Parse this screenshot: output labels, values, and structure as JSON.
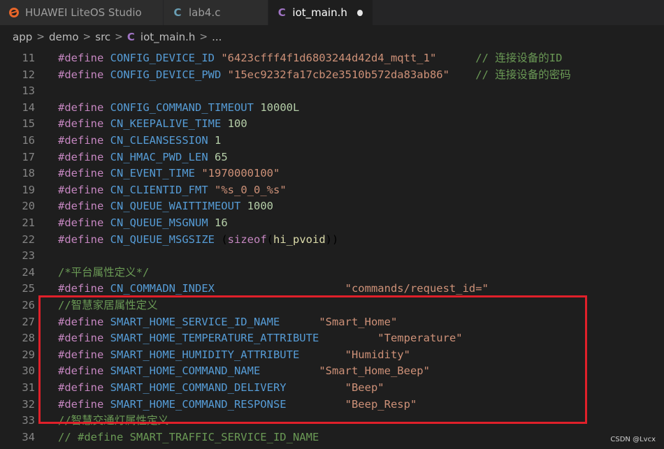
{
  "tabs": [
    {
      "label": "HUAWEI LiteOS Studio",
      "icon": "huawei-liteos-logo-icon"
    },
    {
      "label": "lab4.c",
      "icon": "c-file-icon"
    },
    {
      "label": "iot_main.h",
      "icon": "c-header-file-icon",
      "active": true,
      "modified": true
    }
  ],
  "breadcrumb": [
    "app",
    "demo",
    "src",
    "iot_main.h",
    "..."
  ],
  "lines": [
    {
      "n": "11",
      "t": "#define CONFIG_DEVICE_ID \"6423cfff4f1d6803244d42d4_mqtt_1\"      // 连接设备的ID"
    },
    {
      "n": "12",
      "t": "#define CONFIG_DEVICE_PWD \"15ec9232fa17cb2e3510b572da83ab86\"    // 连接设备的密码"
    },
    {
      "n": "13",
      "t": ""
    },
    {
      "n": "14",
      "t": "#define CONFIG_COMMAND_TIMEOUT 10000L"
    },
    {
      "n": "15",
      "t": "#define CN_KEEPALIVE_TIME 100"
    },
    {
      "n": "16",
      "t": "#define CN_CLEANSESSION 1"
    },
    {
      "n": "17",
      "t": "#define CN_HMAC_PWD_LEN 65"
    },
    {
      "n": "18",
      "t": "#define CN_EVENT_TIME \"1970000100\""
    },
    {
      "n": "19",
      "t": "#define CN_CLIENTID_FMT \"%s_0_0_%s\""
    },
    {
      "n": "20",
      "t": "#define CN_QUEUE_WAITTIMEOUT 1000"
    },
    {
      "n": "21",
      "t": "#define CN_QUEUE_MSGNUM 16"
    },
    {
      "n": "22",
      "t": "#define CN_QUEUE_MSGSIZE (sizeof(hi_pvoid))"
    },
    {
      "n": "23",
      "t": ""
    },
    {
      "n": "24",
      "t": "/*平台属性定义*/"
    },
    {
      "n": "25",
      "t": "#define CN_COMMADN_INDEX                    \"commands/request_id=\""
    },
    {
      "n": "26",
      "t": "//智慧家居属性定义"
    },
    {
      "n": "27",
      "t": "#define SMART_HOME_SERVICE_ID_NAME      \"Smart_Home\""
    },
    {
      "n": "28",
      "t": "#define SMART_HOME_TEMPERATURE_ATTRIBUTE         \"Temperature\""
    },
    {
      "n": "29",
      "t": "#define SMART_HOME_HUMIDITY_ATTRIBUTE       \"Humidity\""
    },
    {
      "n": "30",
      "t": "#define SMART_HOME_COMMAND_NAME         \"Smart_Home_Beep\""
    },
    {
      "n": "31",
      "t": "#define SMART_HOME_COMMAND_DELIVERY         \"Beep\""
    },
    {
      "n": "32",
      "t": "#define SMART_HOME_COMMAND_RESPONSE         \"Beep_Resp\""
    },
    {
      "n": "33",
      "t": "//智慧交通灯属性定义"
    },
    {
      "n": "34",
      "t": "// #define SMART_TRAFFIC_SERVICE_ID_NAME"
    }
  ],
  "watermark": "CSDN @Lvcx",
  "colors": {
    "background": "#1e1e1e",
    "highlight_box": "#e0202a",
    "keyword": "#c586c0",
    "macro": "#569cd6",
    "string": "#ce9178",
    "number": "#b5cea8",
    "comment": "#6a9955"
  }
}
